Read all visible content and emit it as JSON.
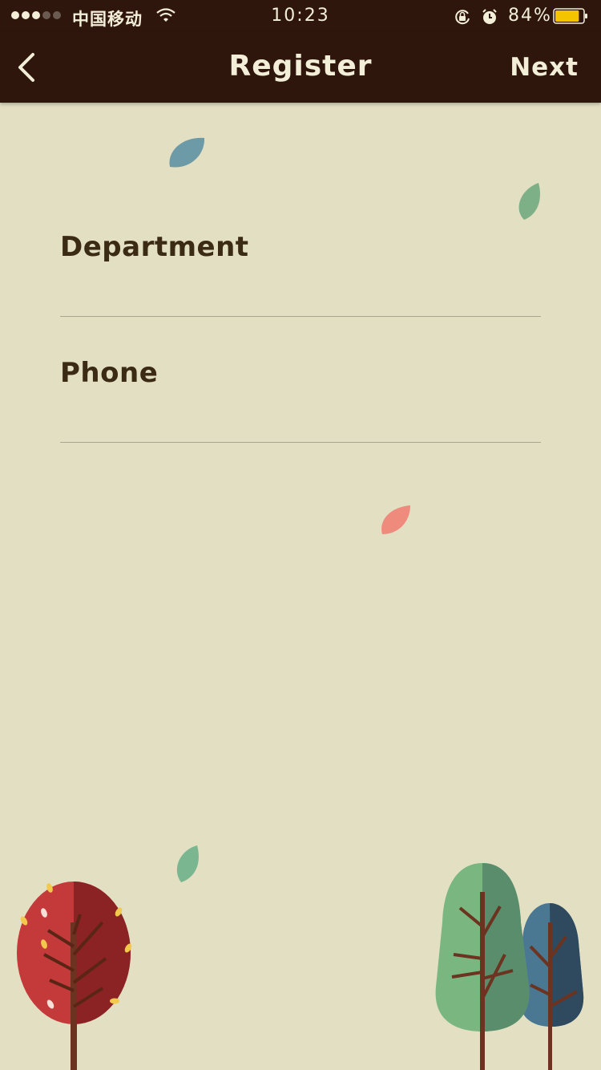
{
  "status_bar": {
    "carrier": "中国移动",
    "time": "10:23",
    "battery_percent": "84%",
    "battery_level": 0.84,
    "signal_bars_filled": 3,
    "signal_bars_total": 5
  },
  "nav": {
    "back_icon": "chevron-left-icon",
    "title": "Register",
    "next_label": "Next"
  },
  "form": {
    "fields": [
      {
        "label": "Department",
        "value": ""
      },
      {
        "label": "Phone",
        "value": ""
      }
    ]
  },
  "colors": {
    "background": "#e2dfc3",
    "navbar": "#2e160d",
    "text_light": "#f2eed8",
    "label": "#3b2a14",
    "battery": "#f5c400"
  }
}
